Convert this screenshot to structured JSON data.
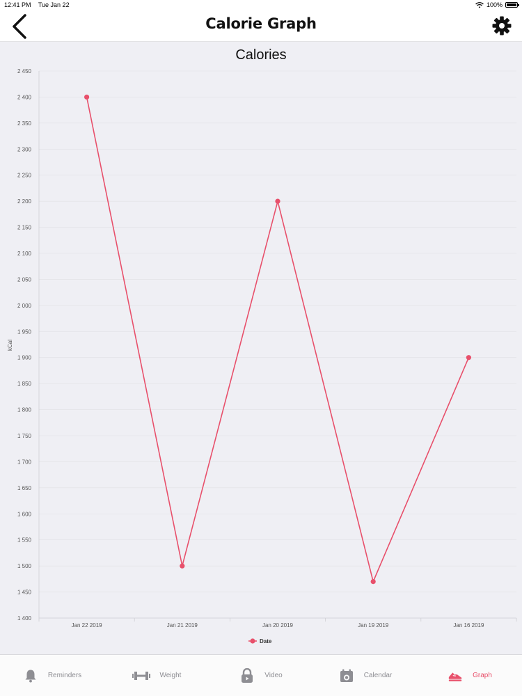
{
  "status_bar": {
    "time": "12:41 PM",
    "date": "Tue Jan 22",
    "battery": "100%"
  },
  "nav": {
    "title": "Calorie Graph"
  },
  "colors": {
    "accent": "#e8506b",
    "inactive": "#8e8e93",
    "chart_bg": "#efeff4"
  },
  "chart_data": {
    "type": "line",
    "title": "Calories",
    "xlabel": "",
    "ylabel": "kCal",
    "categories": [
      "Jan 22 2019",
      "Jan 21 2019",
      "Jan 20 2019",
      "Jan 19 2019",
      "Jan 16 2019"
    ],
    "series": [
      {
        "name": "Date",
        "values": [
          2400,
          1500,
          2200,
          1470,
          1900
        ]
      }
    ],
    "ylim": [
      1400,
      2450
    ],
    "yticks": [
      "2 450",
      "2 400",
      "2 350",
      "2 300",
      "2 250",
      "2 200",
      "2 150",
      "2 100",
      "2 050",
      "2 000",
      "1 950",
      "1 900",
      "1 850",
      "1 800",
      "1 750",
      "1 700",
      "1 650",
      "1 600",
      "1 550",
      "1 500",
      "1 450",
      "1 400"
    ],
    "grid": true,
    "legend": "bottom-center"
  },
  "tabs": [
    {
      "label": "Reminders",
      "icon": "bell-icon"
    },
    {
      "label": "Weight",
      "icon": "dumbbell-icon"
    },
    {
      "label": "Video",
      "icon": "video-lock-icon"
    },
    {
      "label": "Calendar",
      "icon": "calendar-icon"
    },
    {
      "label": "Graph",
      "icon": "running-shoe-icon"
    }
  ]
}
